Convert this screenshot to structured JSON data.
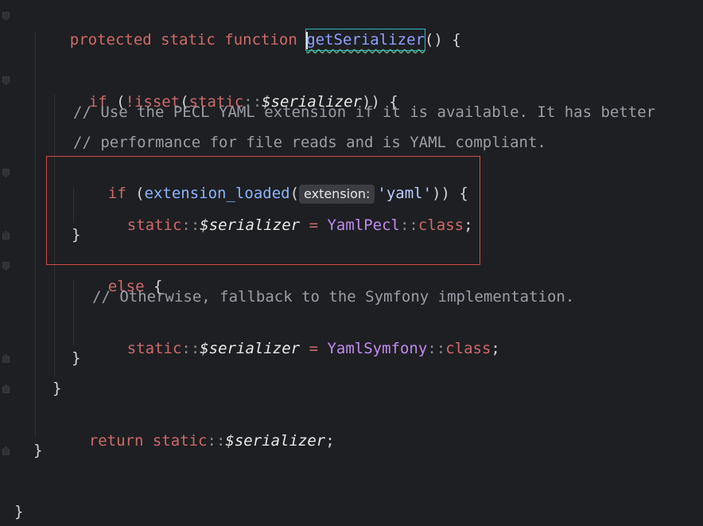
{
  "code": {
    "line1": {
      "kw_protected": "protected",
      "kw_static": "static",
      "kw_function": "function",
      "fn_name": "getSerializer",
      "tail": "() {"
    },
    "line3": {
      "kw_if": "if",
      "open": " (",
      "not_isset": "!isset",
      "paren": "(",
      "kw_static": "static",
      "dc": "::",
      "var": "$serializer",
      "tail": ")) {"
    },
    "comment1": "// Use the PECL YAML extension if it is available. It has better",
    "comment2": "// performance for file reads and is YAML compliant.",
    "line6": {
      "kw_if": "if",
      "open": " (",
      "fn": "extension_loaded",
      "paren": "(",
      "hint": "extension:",
      "str": "'yaml'",
      "tail": ")) {"
    },
    "line7": {
      "kw_static": "static",
      "dc": "::",
      "var": "$serializer",
      "eq": " = ",
      "cls": "YamlPecl",
      "dc2": "::",
      "kw_class": "class",
      "semi": ";"
    },
    "close_brace": "}",
    "kw_else": "else",
    "else_tail": " {",
    "comment3": "// Otherwise, fallback to the Symfony implementation.",
    "line11": {
      "kw_static": "static",
      "dc": "::",
      "var": "$serializer",
      "eq": " = ",
      "cls": "YamlSymfony",
      "dc2": "::",
      "kw_class": "class",
      "semi": ";"
    },
    "line14": {
      "kw_return": "return",
      "kw_static": "static",
      "dc": "::",
      "var": "$serializer",
      "semi": ";"
    }
  },
  "colors": {
    "keyword": "#cf6a6a",
    "function": "#8ab4ff",
    "comment": "#9a9ea6",
    "class": "#c08bf0",
    "highlight_border": "#d84a4a",
    "background": "#1e1f22"
  }
}
